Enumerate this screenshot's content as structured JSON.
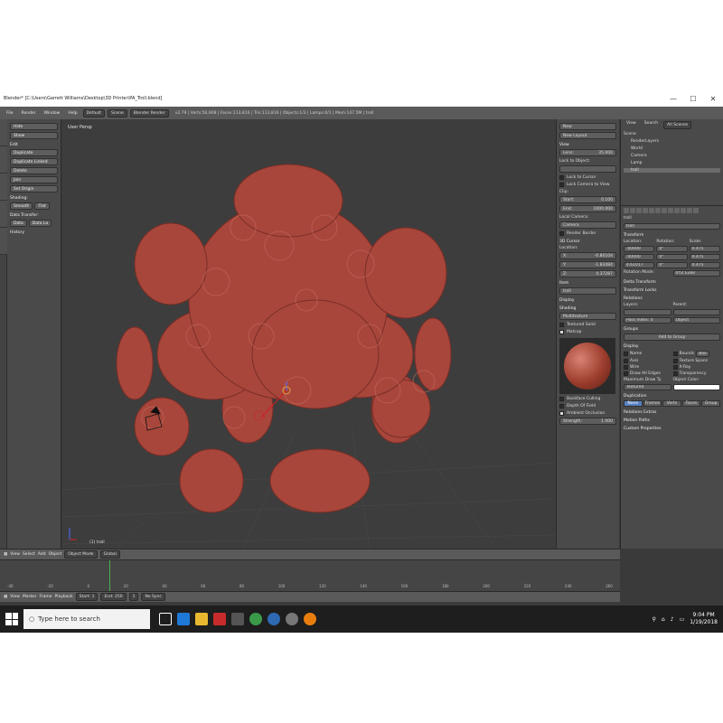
{
  "window": {
    "title": "Blender* [C:\\Users\\Garrett Williams\\Desktop\\3D Printer\\PA_Troll.blend]",
    "minimize": "—",
    "maximize": "☐",
    "close": "✕"
  },
  "infobar": {
    "menus": [
      "File",
      "Render",
      "Window",
      "Help"
    ],
    "layout": "Default",
    "scene": "Scene",
    "engine": "Blender Render",
    "stats": "v2.79 | Verts:56,908 | Faces:113,816 | Tris:113,816 | Objects:1/3 | Lamps:0/1 | Mem:147.5M | troll"
  },
  "toolshelf": {
    "top_buttons": [
      "Hide",
      "Show"
    ],
    "edit_header": "Edit",
    "edit_buttons": [
      "Duplicate",
      "Duplicate Linked",
      "Delete",
      "Join",
      "Set Origin"
    ],
    "shading_header": "Shading:",
    "shading_buttons": [
      "Smooth",
      "Flat"
    ],
    "data_transfer_header": "Data Transfer:",
    "data_buttons": [
      "Data",
      "Data La"
    ],
    "history": "History"
  },
  "viewport": {
    "label": "User Persp",
    "object_label": "(1) troll"
  },
  "npanel": {
    "new_label": "New",
    "new_layout": "New Layout",
    "view_header": "View",
    "lens": {
      "label": "Lens:",
      "value": "35.000"
    },
    "lock_to_object": "Lock to Object:",
    "lock_cursor": "Lock to Cursor",
    "lock_camera": "Lock Camera to View",
    "clip_header": "Clip:",
    "clip_start": {
      "label": "Start:",
      "value": "0.100"
    },
    "clip_end": {
      "label": "End:",
      "value": "1000.000"
    },
    "local_camera": "Local Camera:",
    "camera_field": "Camera",
    "render_border": "Render Border",
    "cursor_header": "3D Cursor",
    "location_label": "Location:",
    "cursor_x": {
      "label": "X:",
      "value": "-0.80104"
    },
    "cursor_y": {
      "label": "Y:",
      "value": "-1.83484"
    },
    "cursor_z": {
      "label": "Z:",
      "value": "4.37287"
    },
    "item_header": "Item",
    "item_name": "troll",
    "display_header": "Display",
    "shading_header": "Shading",
    "shading_mode": "Multitexture",
    "textured_solid": "Textured Solid",
    "matcap": "Matcap",
    "backface_culling": "Backface Culling",
    "depth_of_field": "Depth Of Field",
    "ambient_occlusion": "Ambient Occlusion",
    "strength": {
      "label": "Strength:",
      "value": "1.000"
    }
  },
  "outliner": {
    "tabs": [
      "View",
      "Search",
      "All Scenes"
    ],
    "items": [
      "Scene",
      "RenderLayers",
      "World",
      "Camera",
      "Lamp",
      "troll"
    ]
  },
  "properties": {
    "object_path": "troll",
    "object_name": "troll",
    "transform_header": "Transform",
    "col_location": "Location:",
    "col_rotation": "Rotation:",
    "col_scale": "Scale:",
    "loc": [
      ".00000",
      ".00000",
      "4.61017"
    ],
    "rot": [
      "0°",
      "0°",
      "0°"
    ],
    "scale": [
      "0.475",
      "0.475",
      "0.475"
    ],
    "axis": [
      "X:",
      "Y:",
      "Z:"
    ],
    "rotation_mode_label": "Rotation Mode:",
    "rotation_mode": "XYZ Euler",
    "delta_transform": "Delta Transform",
    "transform_locks": "Transform Locks",
    "relations": "Relations",
    "layers_label": "Layers:",
    "parent_label": "Parent:",
    "parent_type": "Object",
    "pass_index": "Pass Index:",
    "pass_value": "0",
    "groups": "Groups",
    "add_to_group": "Add to Group",
    "display": "Display",
    "display_checks": [
      "Name",
      "Axis",
      "Wire",
      "Draw All Edges",
      "Bounds",
      "Texture Space",
      "X-Ray",
      "Transparency"
    ],
    "bounds_type": "Box",
    "max_draw_type_label": "Maximum Draw Ty",
    "max_draw_type": "Textured",
    "object_color_label": "Object Color:",
    "duplication": "Duplication",
    "dupli_options": [
      "None",
      "Frames",
      "Verts",
      "Faces",
      "Group"
    ],
    "relations_extras": "Relations Extras",
    "motion_paths": "Motion Paths",
    "custom_properties": "Custom Properties"
  },
  "view_header": {
    "menus": [
      "View",
      "Select",
      "Add",
      "Object"
    ],
    "mode": "Object Mode",
    "orientation": "Global"
  },
  "timeline": {
    "ticks": [
      "-40",
      "-20",
      "0",
      "20",
      "40",
      "60",
      "80",
      "100",
      "120",
      "140",
      "160",
      "180",
      "200",
      "220",
      "240",
      "260"
    ],
    "current_frame": 0
  },
  "timeline_header": {
    "menus": [
      "View",
      "Marker",
      "Frame",
      "Playback"
    ],
    "start": "Start:",
    "start_value": "1",
    "end": "End:",
    "end_value": "250",
    "current_value": "1",
    "sync": "No Sync"
  },
  "taskbar": {
    "search_placeholder": "Type here to search",
    "time": "9:04 PM",
    "date": "1/19/2018"
  }
}
